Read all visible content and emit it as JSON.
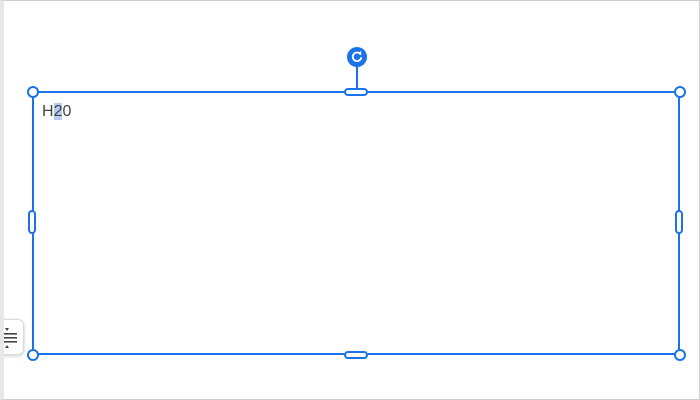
{
  "textbox": {
    "text_before": "H",
    "text_selected": "2",
    "text_after": "0"
  },
  "colors": {
    "accent": "#1a73e8",
    "selection": "#b4cdf0",
    "text": "#444444"
  },
  "icons": {
    "rotate": "rotate-icon",
    "wrap": "text-wrap-icon"
  }
}
